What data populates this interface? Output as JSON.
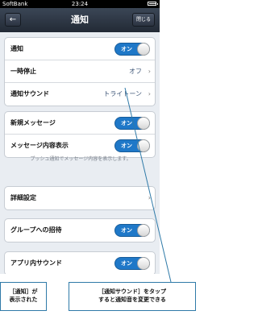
{
  "status_bar": {
    "carrier": "SoftBank",
    "time": "23:24"
  },
  "nav_bar": {
    "back_label": "←",
    "title": "通知",
    "close_label": "閉じる"
  },
  "groups": [
    {
      "rows": [
        {
          "label": "通知",
          "type": "toggle",
          "toggle_label": "オン"
        },
        {
          "label": "一時停止",
          "type": "detail",
          "value": "オフ"
        },
        {
          "label": "通知サウンド",
          "type": "detail",
          "value": "トライトーン"
        }
      ]
    },
    {
      "rows": [
        {
          "label": "新規メッセージ",
          "type": "toggle",
          "toggle_label": "オン"
        },
        {
          "label": "メッセージ内容表示",
          "type": "toggle",
          "toggle_label": "オン"
        }
      ]
    },
    {
      "rows": [
        {
          "label": "詳細設定",
          "type": "detail",
          "value": ""
        }
      ]
    },
    {
      "rows": [
        {
          "label": "グループへの招待",
          "type": "toggle",
          "toggle_label": "オン"
        }
      ]
    },
    {
      "rows": [
        {
          "label": "アプリ内サウンド",
          "type": "toggle",
          "toggle_label": "オン"
        }
      ]
    }
  ],
  "note": "プッシュ通知でメッセージ内容を表示します。",
  "chevron": "›",
  "callouts": {
    "left": {
      "line1": "［通知］が",
      "line2": "表示された"
    },
    "right": {
      "line1": "［通知サウンド］をタップ",
      "line2": "すると通知音を変更できる"
    }
  },
  "colors": {
    "toggle_on": "#1f78c8",
    "nav_bar": "#2f3945",
    "callout_border": "#2f7aa8"
  }
}
